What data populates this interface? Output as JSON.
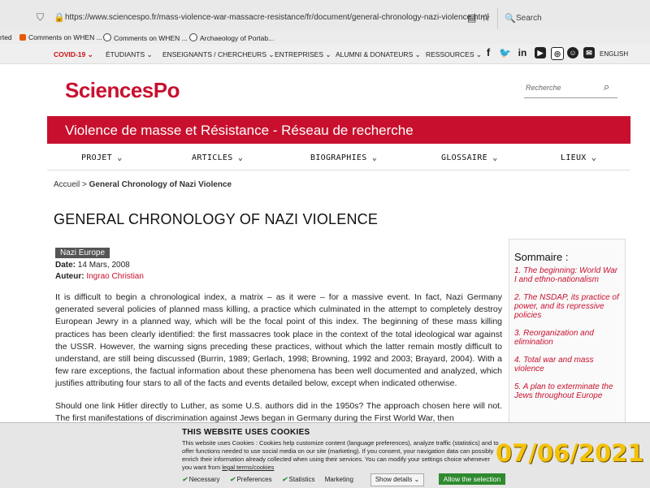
{
  "browser": {
    "url": "https://www.sciencespo.fr/mass-violence-war-massacre-resistance/fr/document/general-chronology-nazi-violence.html",
    "search_label": "Search",
    "bookmarks": [
      "rted",
      "Comments on WHEN ...",
      "Comments on WHEN ...",
      "Archaeology of Portab..."
    ]
  },
  "topnav": {
    "items": [
      "COVID-19",
      "ÉTUDIANTS",
      "ENSEIGNANTS / CHERCHEURS",
      "ENTREPRISES",
      "ALUMNI & DONATEURS",
      "RESSOURCES"
    ],
    "lang": "ENGLISH"
  },
  "header": {
    "logo": "SciencesPo",
    "search_placeholder": "Recherche"
  },
  "banner": {
    "title": "Violence de masse et Résistance - Réseau de recherche"
  },
  "mainnav": [
    "PROJET",
    "ARTICLES",
    "BIOGRAPHIES",
    "GLOSSAIRE",
    "LIEUX"
  ],
  "breadcrumb": {
    "home": "Accueil",
    "sep": ">",
    "current": "General Chronology of Nazi Violence"
  },
  "article": {
    "title": "GENERAL CHRONOLOGY OF NAZI VIOLENCE",
    "tag": "Nazi Europe",
    "date_label": "Date:",
    "date": "14 Mars, 2008",
    "author_label": "Auteur:",
    "author": "Ingrao Christian",
    "paragraphs": [
      "It is difficult to begin a chronological index, a matrix – as it were – for a massive event. In fact, Nazi Germany generated several policies of planned mass killing, a practice which culminated in the attempt to completely destroy European Jewry in a planned way, which will be the focal point of this index. The beginning of these mass killing practices has been clearly identified: the first massacres took place in the context of the total ideological war against the USSR. However, the warning signs preceding these practices, without which the latter remain mostly difficult to understand, are still being discussed (Burrin, 1989; Gerlach, 1998; Browning, 1992 and 2003; Brayard, 2004). With a few rare exceptions, the factual information about these phenomena has been well documented and analyzed, which justifies attributing four stars to all of the facts and events detailed below, except when indicated otherwise.",
      "Should one link Hitler directly to Luther, as some U.S. authors did in the 1950s? The approach chosen here will not. The first manifestations of discrimination against Jews began in Germany during the First World War, then"
    ]
  },
  "sommaire": {
    "heading": "Sommaire :",
    "items": [
      "1. The beginning: World War I and ethno-nationalism",
      "2. The NSDAP, its practice of power, and its repressive policies",
      "3. Reorganization and elimination",
      "4. Total war and mass violence",
      "5. A plan to exterminate the Jews throughout Europe"
    ]
  },
  "cookie": {
    "title": "THIS WEBSITE USES COOKIES",
    "text": "This website uses Cookies : Cookies help customize content (language preferences), analyze traffic (statistics) and to offer functions needed to use social media on our site (marketing). If you consent, your navigation data can possibly enrich their information already collected when using their services. You can modify your settings choice whenever you want from",
    "link": "legal terms/cookies",
    "options": [
      "Necessary",
      "Preferences",
      "Statistics",
      "Marketing"
    ],
    "details": "Show details",
    "allow": "Allow the selection"
  },
  "datestamp": "07/06/2021",
  "colors": {
    "brand": "#c8102e",
    "allow": "#2f8a2f",
    "stamp": "#f3c20a"
  }
}
